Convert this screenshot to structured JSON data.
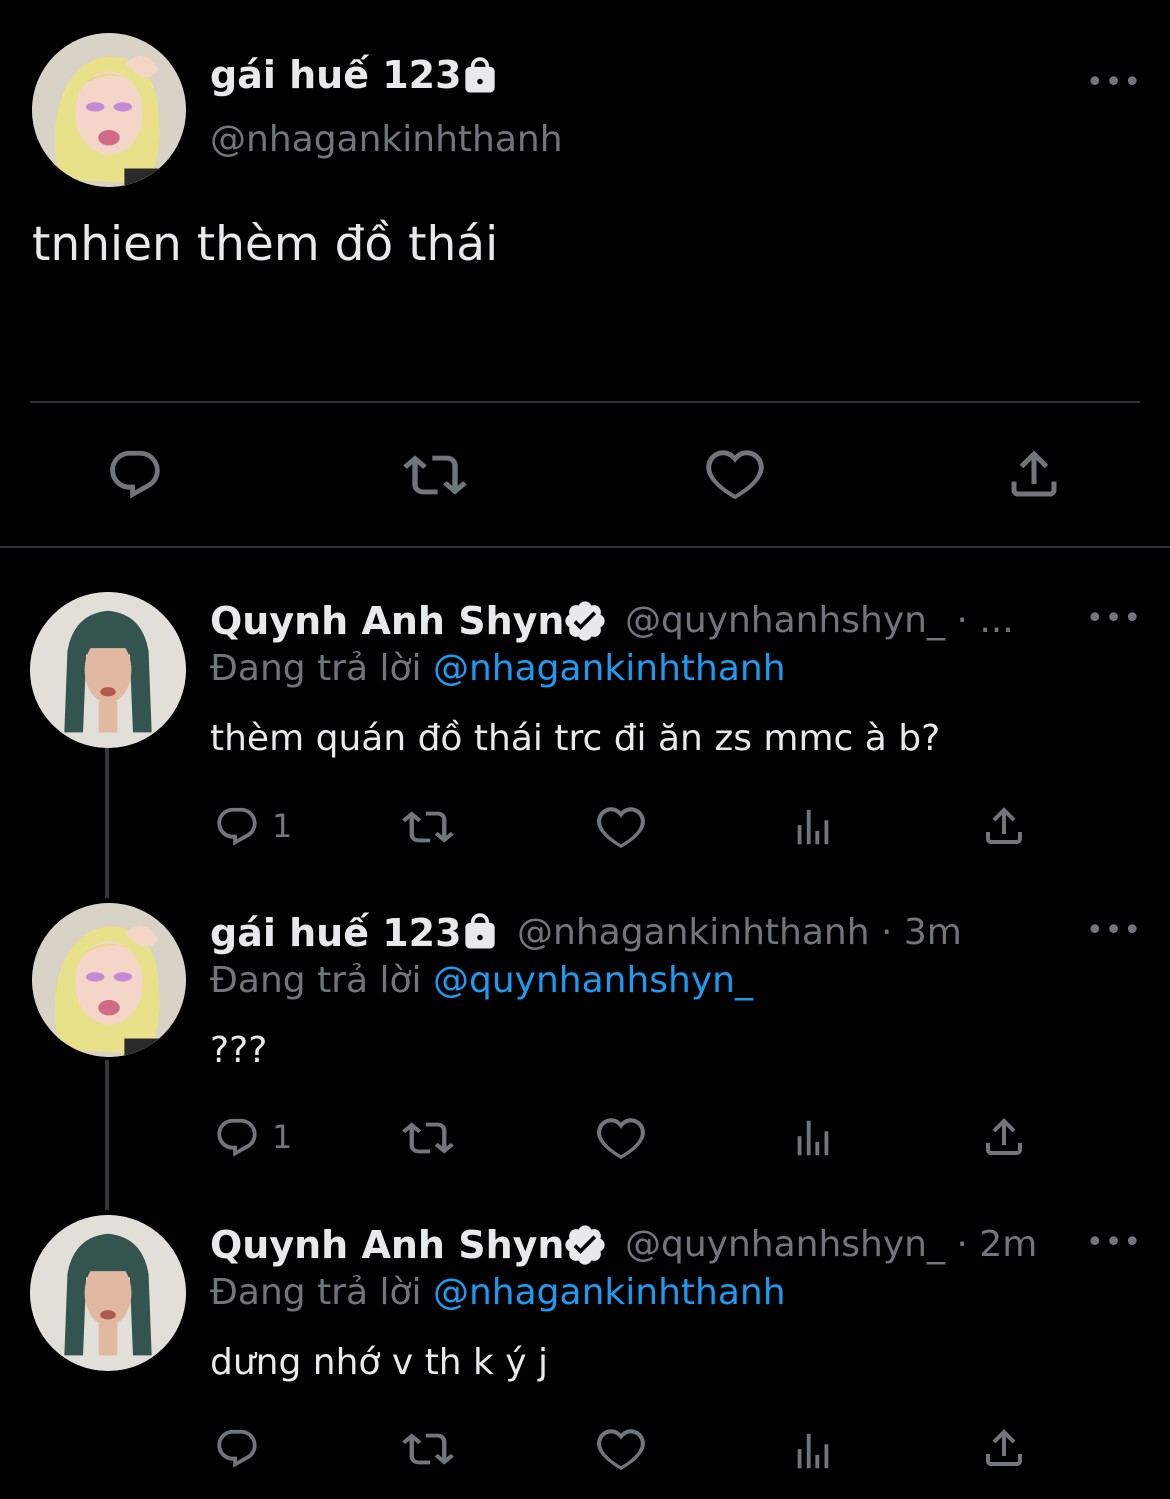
{
  "main_tweet": {
    "display_name": "gái huế 123",
    "handle": "@nhagankinhthanh",
    "text": "tnhien thèm đồ thái",
    "avatar": "anime-blonde-avatar",
    "protected_icon": "lock-icon"
  },
  "replies": [
    {
      "display_name": "Quynh Anh Shyn",
      "verified": true,
      "handle_time": "@quynhanhshyn_ · ...",
      "replying_prefix": "Đang trả lời",
      "replying_to": "@nhagankinhthanh",
      "text": "thèm quán đồ thái trc đi ăn zs mmc à b?",
      "reply_count": "1"
    },
    {
      "display_name": "gái huế 123",
      "protected": true,
      "handle_time": "@nhagankinhthanh · 3m",
      "replying_prefix": "Đang trả lời",
      "replying_to": "@quynhanhshyn_",
      "text": "???",
      "reply_count": "1"
    },
    {
      "display_name": "Quynh Anh Shyn",
      "verified": true,
      "handle_time": "@quynhanhshyn_ · 2m",
      "replying_prefix": "Đang trả lời",
      "replying_to": "@nhagankinhthanh",
      "text": "dưng nhớ v th k ý j",
      "reply_count": ""
    }
  ],
  "icons": {
    "reply": "reply-icon",
    "retweet": "retweet-icon",
    "like": "heart-icon",
    "views": "views-icon",
    "share": "share-icon",
    "more": "more-icon"
  },
  "more_label": "•••",
  "colors": {
    "background": "#000000",
    "text": "#e7e9ea",
    "muted": "#71767b",
    "link": "#1d9bf0",
    "divider": "#2f3336"
  }
}
